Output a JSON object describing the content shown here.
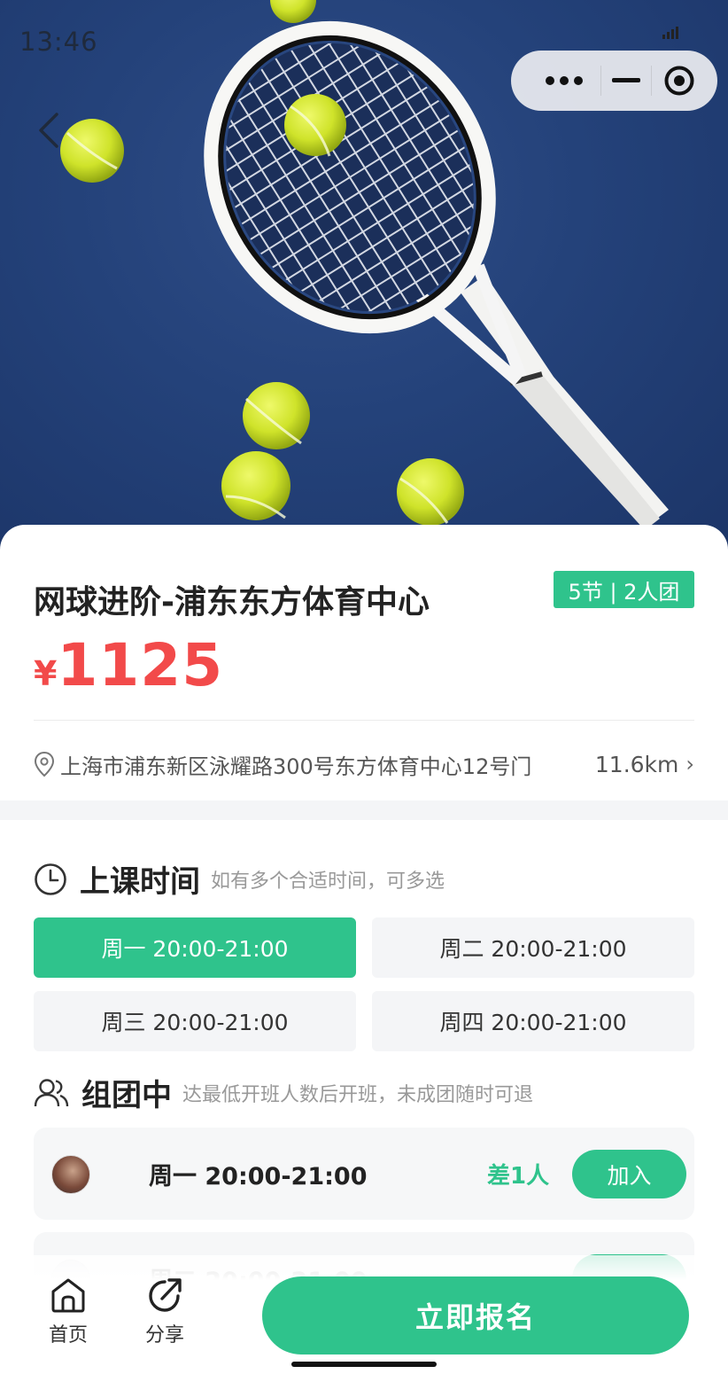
{
  "status_bar": {
    "time": "13:46"
  },
  "capsule": {
    "more_icon": "more-dots-icon",
    "minimize_icon": "minimize-icon",
    "close_icon": "target-circle-icon"
  },
  "course": {
    "title": "网球进阶-浦东东方体育中心",
    "badge": "5节 | 2人团",
    "currency": "¥",
    "price": "1125",
    "address": "上海市浦东新区泳耀路300号东方体育中心12号门",
    "distance": "11.6km",
    "chevron": "›"
  },
  "schedule": {
    "title": "上课时间",
    "subtitle": "如有多个合适时间，可多选",
    "slots": [
      {
        "label": "周一 20:00-21:00",
        "selected": true
      },
      {
        "label": "周二 20:00-21:00",
        "selected": false
      },
      {
        "label": "周三 20:00-21:00",
        "selected": false
      },
      {
        "label": "周四 20:00-21:00",
        "selected": false
      }
    ]
  },
  "groups": {
    "title": "组团中",
    "subtitle": "达最低开班人数后开班，未成团随时可退",
    "items": [
      {
        "time": "周一 20:00-21:00",
        "need": "差1人",
        "action": "加入"
      },
      {
        "time": "周二 20:00-21:00",
        "need": "",
        "action": ""
      }
    ]
  },
  "bottom_bar": {
    "home_label": "首页",
    "share_label": "分享",
    "cta_label": "立即报名"
  },
  "colors": {
    "accent": "#2fc38c",
    "price": "#f24a4a",
    "court": "#24427a"
  }
}
